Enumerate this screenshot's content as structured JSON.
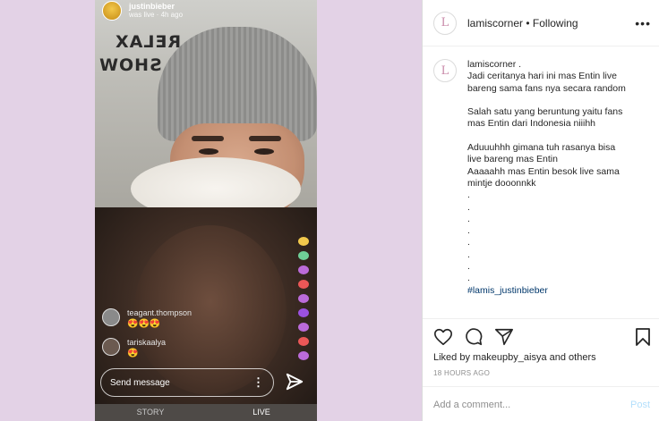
{
  "live": {
    "host_name": "justinbieber",
    "host_status": "was live · 4h ago",
    "wall_text_1": "RELAX",
    "wall_text_2": "E SHOW",
    "comments": [
      {
        "name": "teagant.thompson",
        "text": "😍😍😍"
      },
      {
        "name": "tariskaalya",
        "text": "😍"
      }
    ],
    "send_placeholder": "Send message",
    "more_symbol": "⋮",
    "tabs": [
      "STORY",
      "LIVE"
    ],
    "active_tab": "LIVE",
    "heart_colors": [
      "#f2c94c",
      "#6fcf97",
      "#bb6bd9",
      "#eb5757",
      "#bb6bd9",
      "#9b51e0",
      "#bb6bd9",
      "#eb5757",
      "#bb6bd9"
    ]
  },
  "post": {
    "username": "lamiscorner",
    "following": "• Following",
    "more_icon": "•••",
    "avatar_letter": "L",
    "caption_user": "lamiscorner .",
    "caption_lines": [
      "Jadi ceritanya hari ini mas Entin live",
      "bareng sama fans nya secara random",
      "",
      "Salah satu yang beruntung yaitu fans",
      "mas Entin dari Indonesia niiihh",
      "",
      "Aduuuhhh gimana tuh rasanya bisa",
      "live bareng mas Entin",
      "Aaaaahh mas Entin besok live sama",
      "mintje dooonnkk",
      ".",
      ".",
      ".",
      ".",
      ".",
      ".",
      ".",
      "."
    ],
    "hashtag": "#lamis_justinbieber",
    "liked_by": "Liked by makeupby_aisya and others",
    "time": "18 HOURS AGO",
    "add_comment": "Add a comment...",
    "post_button": "Post"
  }
}
